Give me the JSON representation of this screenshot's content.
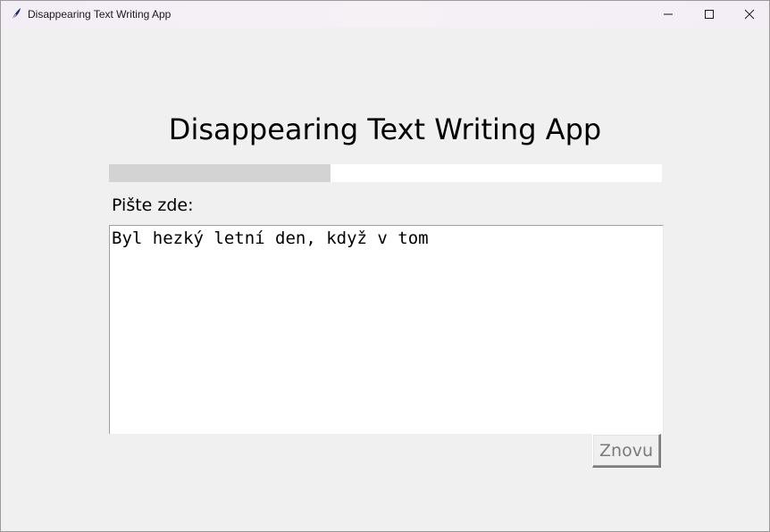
{
  "window": {
    "title": "Disappearing Text Writing App",
    "controls": {
      "minimize_icon": "minimize-icon",
      "maximize_icon": "maximize-icon",
      "close_icon": "close-icon"
    },
    "app_icon": "feather-icon"
  },
  "app": {
    "heading": "Disappearing Text Writing App",
    "progress": 0.4,
    "prompt_label": "Pište zde:",
    "text_value": "Byl hezký letní den, když v tom",
    "reset_label": "Znovu"
  },
  "colors": {
    "background": "#f0f0f0",
    "progress_fill": "#d3d3d3",
    "progress_track": "#ffffff",
    "disabled_text": "#7a7a7a"
  }
}
